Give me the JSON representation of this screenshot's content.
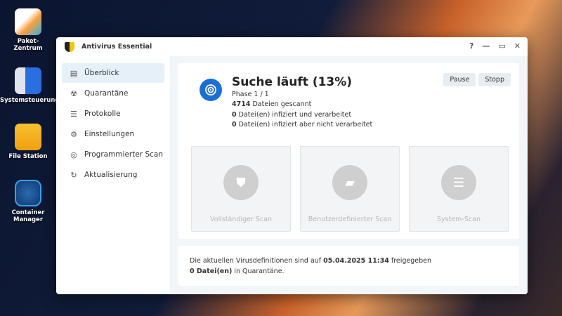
{
  "desktop": [
    {
      "label1": "Paket-",
      "label2": "Zentrum"
    },
    {
      "label1": "Systemsteuerung"
    },
    {
      "label1": "File Station"
    },
    {
      "label1": "Container Manager"
    }
  ],
  "window": {
    "title": "Antivirus Essential",
    "help": "?",
    "minimize": "—",
    "maximize": "▭",
    "close": "✕"
  },
  "sidebar": {
    "items": [
      {
        "label": "Überblick",
        "icon": "▤"
      },
      {
        "label": "Quarantäne",
        "icon": "☢"
      },
      {
        "label": "Protokolle",
        "icon": "☰"
      },
      {
        "label": "Einstellungen",
        "icon": "⚙"
      },
      {
        "label": "Programmierter Scan",
        "icon": "◎"
      },
      {
        "label": "Aktualisierung",
        "icon": "↻"
      }
    ]
  },
  "status": {
    "title": "Suche läuft (13%)",
    "progress_percent": 13,
    "phase": "Phase 1 / 1",
    "scanned_count": "4714",
    "scanned_text": " Dateien gescannt",
    "infected_processed_count": "0",
    "infected_processed_text": " Datei(en) infiziert und verarbeitet",
    "infected_unprocessed_count": "0",
    "infected_unprocessed_text": " Datei(en) infiziert aber nicht verarbeitet"
  },
  "buttons": {
    "pause": "Pause",
    "stop": "Stopp"
  },
  "scans": [
    {
      "label": "Vollständiger Scan",
      "icon": "⛊"
    },
    {
      "label": "Benutzerdefinierter Scan",
      "icon": "▰"
    },
    {
      "label": "System-Scan",
      "icon": "☰"
    }
  ],
  "footer": {
    "defs_prefix": "Die aktuellen Virusdefinitionen sind auf ",
    "defs_date": "05.04.2025 11:34",
    "defs_suffix": " freigegeben",
    "quarantine_count": "0 Datei(en)",
    "quarantine_suffix": " in Quarantäne."
  }
}
